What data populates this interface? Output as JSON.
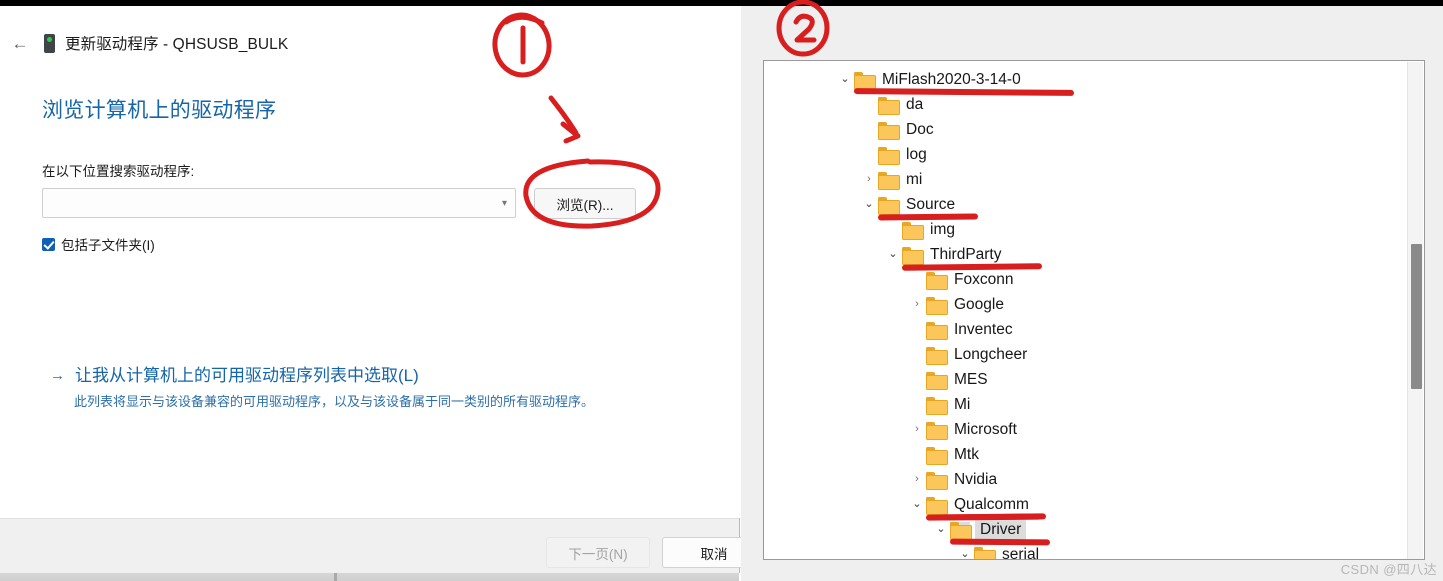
{
  "wizard": {
    "back_icon": "back-arrow-icon",
    "device_icon": "device-icon",
    "title": "更新驱动程序 - QHSUSB_BULK",
    "heading": "浏览计算机上的驱动程序",
    "field_label": "在以下位置搜索驱动程序:",
    "path_value": "",
    "path_placeholder": "",
    "caret_icon": "chevron-down-icon",
    "browse_label": "浏览(R)...",
    "include_subfolders_label": "包括子文件夹(I)",
    "include_subfolders_checked": true,
    "link_arrow": "→",
    "link_title": "让我从计算机上的可用驱动程序列表中选取(L)",
    "link_desc": "此列表将显示与该设备兼容的可用驱动程序，以及与该设备属于同一类别的所有驱动程序。",
    "next_label": "下一页(N)",
    "next_disabled": true,
    "cancel_label": "取消"
  },
  "tree": {
    "items": [
      {
        "label": "MiFlash2020-3-14-0",
        "depth": 0,
        "chevron": "open",
        "underline": true,
        "selected": false
      },
      {
        "label": "da",
        "depth": 1,
        "chevron": "none",
        "underline": false,
        "selected": false
      },
      {
        "label": "Doc",
        "depth": 1,
        "chevron": "none",
        "underline": false,
        "selected": false
      },
      {
        "label": "log",
        "depth": 1,
        "chevron": "none",
        "underline": false,
        "selected": false
      },
      {
        "label": "mi",
        "depth": 1,
        "chevron": "closed",
        "underline": false,
        "selected": false
      },
      {
        "label": "Source",
        "depth": 1,
        "chevron": "open",
        "underline": true,
        "selected": false
      },
      {
        "label": "img",
        "depth": 2,
        "chevron": "none",
        "underline": false,
        "selected": false
      },
      {
        "label": "ThirdParty",
        "depth": 2,
        "chevron": "open",
        "underline": true,
        "selected": false
      },
      {
        "label": "Foxconn",
        "depth": 3,
        "chevron": "none",
        "underline": false,
        "selected": false
      },
      {
        "label": "Google",
        "depth": 3,
        "chevron": "closed",
        "underline": false,
        "selected": false
      },
      {
        "label": "Inventec",
        "depth": 3,
        "chevron": "none",
        "underline": false,
        "selected": false
      },
      {
        "label": "Longcheer",
        "depth": 3,
        "chevron": "none",
        "underline": false,
        "selected": false
      },
      {
        "label": "MES",
        "depth": 3,
        "chevron": "none",
        "underline": false,
        "selected": false
      },
      {
        "label": "Mi",
        "depth": 3,
        "chevron": "none",
        "underline": false,
        "selected": false
      },
      {
        "label": "Microsoft",
        "depth": 3,
        "chevron": "closed",
        "underline": false,
        "selected": false
      },
      {
        "label": "Mtk",
        "depth": 3,
        "chevron": "none",
        "underline": false,
        "selected": false
      },
      {
        "label": "Nvidia",
        "depth": 3,
        "chevron": "closed",
        "underline": false,
        "selected": false
      },
      {
        "label": "Qualcomm",
        "depth": 3,
        "chevron": "open",
        "underline": true,
        "selected": false
      },
      {
        "label": "Driver",
        "depth": 4,
        "chevron": "open",
        "underline": true,
        "selected": true
      },
      {
        "label": "serial",
        "depth": 5,
        "chevron": "open",
        "underline": false,
        "selected": false
      }
    ],
    "scrollbar": "vertical-scrollbar"
  },
  "annotations": {
    "marker_one": "1",
    "marker_two": "2",
    "arrow_icon": "hand-drawn-arrow",
    "ellipse_icon": "hand-drawn-ellipse",
    "accent_color": "#d81f1f"
  },
  "watermark": {
    "text": "CSDN @四八达"
  }
}
